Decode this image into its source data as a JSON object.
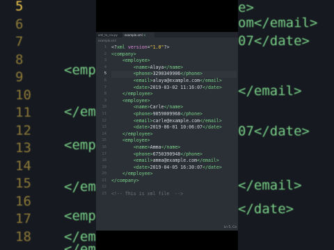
{
  "background": {
    "left_lines": [
      {
        "text": "5",
        "kind": "ln"
      },
      {
        "text": "6",
        "kind": "ln"
      },
      {
        "text": "7",
        "kind": "ln"
      },
      {
        "text": "8",
        "kind": "ln"
      },
      {
        "text": "9",
        "kind": "ln"
      },
      {
        "text": "10",
        "kind": "ln"
      },
      {
        "text": "11",
        "kind": "ln"
      },
      {
        "text": "12",
        "kind": "ln"
      },
      {
        "text": "13",
        "kind": "ln"
      },
      {
        "text": "14",
        "kind": "ln"
      },
      {
        "text": "15",
        "kind": "ln"
      },
      {
        "text": "16",
        "kind": "ln"
      },
      {
        "text": "17",
        "kind": "ln"
      },
      {
        "text": "18",
        "kind": "ln"
      }
    ],
    "left_text": [
      "<emplo",
      "</empl",
      "<emplo",
      "</empl",
      "<emplo",
      "</empl",
      "</emplo"
    ],
    "right_text": [
      "e>",
      "om</email>",
      "07</date>",
      "</email>",
      "07</date>",
      "</email>",
      "</date>"
    ]
  },
  "editor": {
    "tabs": [
      {
        "label": "xml_to_csv.py",
        "active": false
      },
      {
        "label": "example.xml",
        "active": true
      }
    ],
    "breadcrumb": "example.xml",
    "status": "Ln 5, Co",
    "lines": [
      {
        "n": "1",
        "parts": [
          [
            "p",
            "<?"
          ],
          [
            "t",
            "xml "
          ],
          [
            "a",
            "version"
          ],
          [
            "p",
            "="
          ],
          [
            "s",
            "\"1.0\""
          ],
          [
            "p",
            "?>"
          ]
        ]
      },
      {
        "n": "2",
        "parts": [
          [
            "t",
            "<company>"
          ]
        ]
      },
      {
        "n": "3",
        "parts": [
          [
            "p",
            "    "
          ],
          [
            "t",
            "<employee>"
          ]
        ]
      },
      {
        "n": "4",
        "parts": [
          [
            "p",
            "        "
          ],
          [
            "t",
            "<name>"
          ],
          [
            "p",
            "Alaya"
          ],
          [
            "t",
            "</name>"
          ]
        ]
      },
      {
        "n": "5",
        "parts": [
          [
            "p",
            "        "
          ],
          [
            "t",
            "<phone>"
          ],
          [
            "p",
            "3290349906"
          ],
          [
            "t",
            "</phone>"
          ]
        ],
        "active": true
      },
      {
        "n": "6",
        "parts": [
          [
            "p",
            "        "
          ],
          [
            "t",
            "<email>"
          ],
          [
            "p",
            "alaya@example.com"
          ],
          [
            "t",
            "</email>"
          ]
        ]
      },
      {
        "n": "7",
        "parts": [
          [
            "p",
            "        "
          ],
          [
            "t",
            "<date>"
          ],
          [
            "p",
            "2019-03-02 11:16:07"
          ],
          [
            "t",
            "</date>"
          ]
        ]
      },
      {
        "n": "8",
        "parts": [
          [
            "p",
            "    "
          ],
          [
            "t",
            "</employee>"
          ]
        ]
      },
      {
        "n": "9",
        "parts": [
          [
            "p",
            "    "
          ],
          [
            "t",
            "<employee>"
          ]
        ]
      },
      {
        "n": "10",
        "parts": [
          [
            "p",
            "        "
          ],
          [
            "t",
            "<name>"
          ],
          [
            "p",
            "Carle"
          ],
          [
            "t",
            "</name>"
          ]
        ]
      },
      {
        "n": "11",
        "parts": [
          [
            "p",
            "        "
          ],
          [
            "t",
            "<phone>"
          ],
          [
            "p",
            "9059009968"
          ],
          [
            "t",
            "</phone>"
          ]
        ]
      },
      {
        "n": "12",
        "parts": [
          [
            "p",
            "        "
          ],
          [
            "t",
            "<email>"
          ],
          [
            "p",
            "carle@example.com"
          ],
          [
            "t",
            "</email>"
          ]
        ]
      },
      {
        "n": "13",
        "parts": [
          [
            "p",
            "        "
          ],
          [
            "t",
            "<date>"
          ],
          [
            "p",
            "2019-06-01 10:06:07"
          ],
          [
            "t",
            "</date>"
          ]
        ]
      },
      {
        "n": "14",
        "parts": [
          [
            "p",
            "    "
          ],
          [
            "t",
            "</employee>"
          ]
        ]
      },
      {
        "n": "15",
        "parts": [
          [
            "p",
            "    "
          ],
          [
            "t",
            "<employee>"
          ]
        ]
      },
      {
        "n": "16",
        "parts": [
          [
            "p",
            "        "
          ],
          [
            "t",
            "<name>"
          ],
          [
            "p",
            "Amma"
          ],
          [
            "t",
            "</name>"
          ]
        ]
      },
      {
        "n": "17",
        "parts": [
          [
            "p",
            "        "
          ],
          [
            "t",
            "<phone>"
          ],
          [
            "p",
            "6750390948"
          ],
          [
            "t",
            "</phone>"
          ]
        ]
      },
      {
        "n": "18",
        "parts": [
          [
            "p",
            "        "
          ],
          [
            "t",
            "<email>"
          ],
          [
            "p",
            "amma@example.com"
          ],
          [
            "t",
            "</email>"
          ]
        ]
      },
      {
        "n": "19",
        "parts": [
          [
            "p",
            "        "
          ],
          [
            "t",
            "<date>"
          ],
          [
            "p",
            "2019-04-05 16:30:07"
          ],
          [
            "t",
            "</date>"
          ]
        ]
      },
      {
        "n": "20",
        "parts": [
          [
            "p",
            "    "
          ],
          [
            "t",
            "</employee>"
          ]
        ]
      },
      {
        "n": "21",
        "parts": [
          [
            "t",
            "</company>"
          ]
        ]
      },
      {
        "n": "22",
        "parts": []
      },
      {
        "n": "23",
        "parts": [
          [
            "c",
            "<!-- This is xml file  -->"
          ]
        ]
      }
    ]
  }
}
